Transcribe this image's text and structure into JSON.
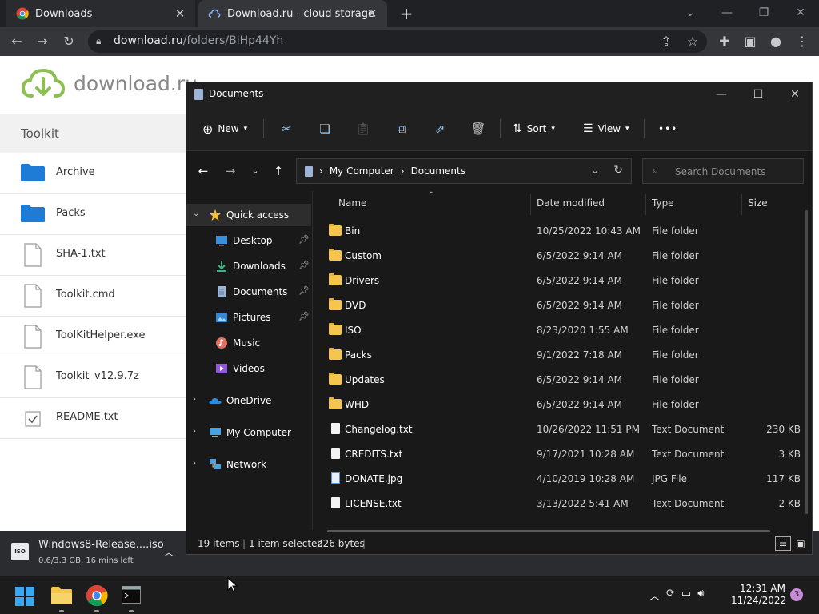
{
  "browser": {
    "tabs": [
      {
        "title": "Downloads",
        "active": false
      },
      {
        "title": "Download.ru - cloud storage",
        "active": true
      }
    ],
    "url_host": "download.ru",
    "url_path": "/folders/BiHp44Yh"
  },
  "website": {
    "logo_text": "download.ru",
    "section_title": "Toolkit",
    "items": [
      {
        "label": "Archive",
        "icon": "folder-icon"
      },
      {
        "label": "Packs",
        "icon": "folder-icon"
      },
      {
        "label": "SHA-1.txt",
        "icon": "file-icon"
      },
      {
        "label": "Toolkit.cmd",
        "icon": "file-icon"
      },
      {
        "label": "ToolKitHelper.exe",
        "icon": "file-icon"
      },
      {
        "label": "Toolkit_v12.9.7z",
        "icon": "file-icon"
      },
      {
        "label": "README.txt",
        "icon": "checkbox-icon"
      }
    ],
    "accent": "#8cc152"
  },
  "download_shelf": {
    "file_name": "Windows8-Release....iso",
    "status": "0.6/3.3 GB, 16 mins left",
    "icon_text": "ISO"
  },
  "explorer": {
    "title": "Documents",
    "commands": {
      "new": "New",
      "sort": "Sort",
      "view": "View",
      "more": "•••"
    },
    "breadcrumb": [
      "My Computer",
      "Documents"
    ],
    "search_placeholder": "Search Documents",
    "nav": [
      {
        "label": "Quick access",
        "icon": "star-icon",
        "level": 0,
        "expanded": true,
        "selected": true
      },
      {
        "label": "Desktop",
        "icon": "desktop-icon",
        "level": 1,
        "pinned": true
      },
      {
        "label": "Downloads",
        "icon": "download-icon",
        "level": 1,
        "pinned": true
      },
      {
        "label": "Documents",
        "icon": "document-icon",
        "level": 1,
        "pinned": true
      },
      {
        "label": "Pictures",
        "icon": "pictures-icon",
        "level": 1,
        "pinned": true
      },
      {
        "label": "Music",
        "icon": "music-icon",
        "level": 1
      },
      {
        "label": "Videos",
        "icon": "videos-icon",
        "level": 1
      },
      {
        "label": "OneDrive",
        "icon": "cloud-icon",
        "level": 0
      },
      {
        "label": "My Computer",
        "icon": "computer-icon",
        "level": 0
      },
      {
        "label": "Network",
        "icon": "network-icon",
        "level": 0
      }
    ],
    "columns": [
      "Name",
      "Date modified",
      "Type",
      "Size"
    ],
    "files": [
      {
        "name": "Bin",
        "date": "10/25/2022 10:43 AM",
        "type": "File folder",
        "size": "",
        "kind": "folder"
      },
      {
        "name": "Custom",
        "date": "6/5/2022 9:14 AM",
        "type": "File folder",
        "size": "",
        "kind": "folder"
      },
      {
        "name": "Drivers",
        "date": "6/5/2022 9:14 AM",
        "type": "File folder",
        "size": "",
        "kind": "folder"
      },
      {
        "name": "DVD",
        "date": "6/5/2022 9:14 AM",
        "type": "File folder",
        "size": "",
        "kind": "folder"
      },
      {
        "name": "ISO",
        "date": "8/23/2020 1:55 AM",
        "type": "File folder",
        "size": "",
        "kind": "folder"
      },
      {
        "name": "Packs",
        "date": "9/1/2022 7:18 AM",
        "type": "File folder",
        "size": "",
        "kind": "folder"
      },
      {
        "name": "Updates",
        "date": "6/5/2022 9:14 AM",
        "type": "File folder",
        "size": "",
        "kind": "folder"
      },
      {
        "name": "WHD",
        "date": "6/5/2022 9:14 AM",
        "type": "File folder",
        "size": "",
        "kind": "folder"
      },
      {
        "name": "Changelog.txt",
        "date": "10/26/2022 11:51 PM",
        "type": "Text Document",
        "size": "230 KB",
        "kind": "txt"
      },
      {
        "name": "CREDITS.txt",
        "date": "9/17/2021 10:28 AM",
        "type": "Text Document",
        "size": "3 KB",
        "kind": "txt"
      },
      {
        "name": "DONATE.jpg",
        "date": "4/10/2019 10:28 AM",
        "type": "JPG File",
        "size": "117 KB",
        "kind": "jpg"
      },
      {
        "name": "LICENSE.txt",
        "date": "3/13/2022 5:41 AM",
        "type": "Text Document",
        "size": "2 KB",
        "kind": "txt"
      }
    ],
    "status": {
      "count": "19 items",
      "selected": "1 item selected",
      "size": "226 bytes"
    }
  },
  "taskbar": {
    "clock_time": "12:31 AM",
    "clock_date": "11/24/2022",
    "notification_count": "3"
  }
}
